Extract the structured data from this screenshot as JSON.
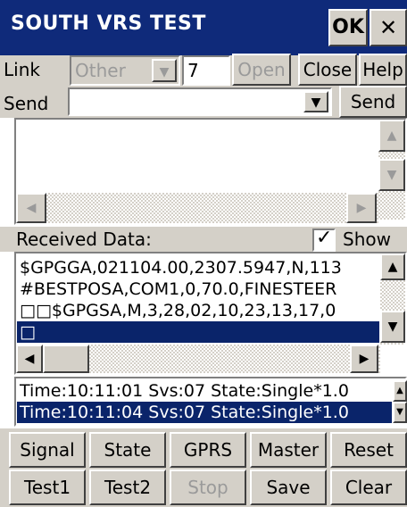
{
  "window": {
    "title": "SOUTH VRS TEST",
    "ok_label": "OK",
    "close_glyph": "✕"
  },
  "link_row": {
    "label": "Link",
    "select_value": "Other",
    "port_value": "7",
    "open_label": "Open",
    "close_label": "Close",
    "help_label": "Help"
  },
  "send_row": {
    "label": "Send",
    "input_value": "",
    "send_label": "Send"
  },
  "received": {
    "label": "Received Data:",
    "show_label": "Show",
    "show_checked": true,
    "lines": [
      "$GPGGA,021104.00,2307.5947,N,113",
      "#BESTPOSA,COM1,0,70.0,FINESTEER",
      "□□$GPGSA,M,3,28,02,10,23,13,17,0",
      "□"
    ]
  },
  "status": {
    "lines": [
      "Time:10:11:01 Svs:07 State:Single*1.0",
      "Time:10:11:04 Svs:07 State:Single*1.0"
    ]
  },
  "buttons_row1": [
    "Signal",
    "State",
    "GPRS",
    "Master",
    "Reset"
  ],
  "buttons_row2": [
    "Test1",
    "Test2",
    "Stop",
    "Save",
    "Clear"
  ],
  "icons": {
    "dropdown": "down-arrow",
    "check": "checkmark"
  }
}
